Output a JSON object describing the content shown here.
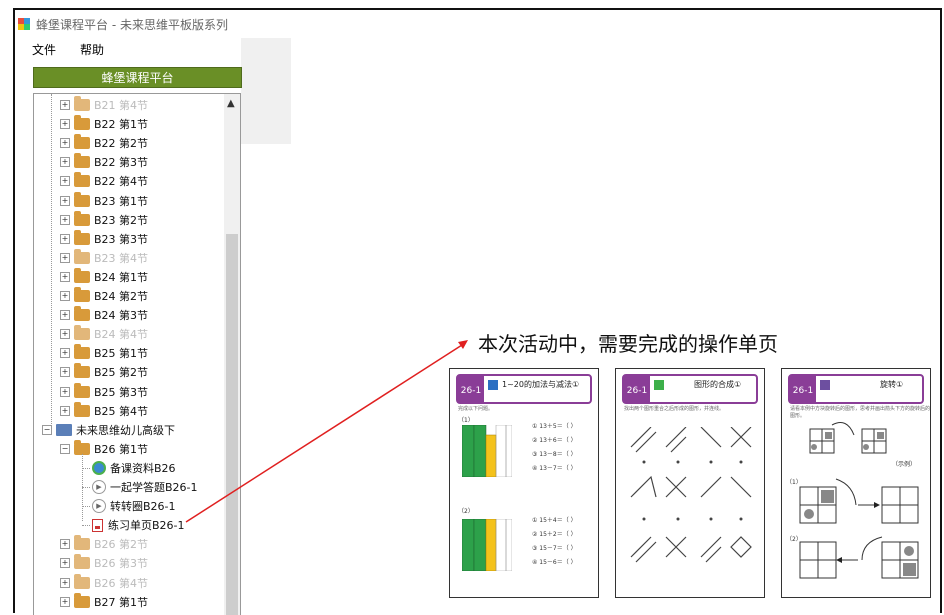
{
  "window": {
    "title": "蜂堡课程平台 - 未来思维平板版系列"
  },
  "menu": {
    "file": "文件",
    "help": "帮助"
  },
  "platform_button": "蜂堡课程平台",
  "tree": {
    "items": [
      {
        "label": "B21 第4节",
        "dim": true
      },
      {
        "label": "B22 第1节",
        "dim": false
      },
      {
        "label": "B22 第2节",
        "dim": false
      },
      {
        "label": "B22 第3节",
        "dim": false
      },
      {
        "label": "B22 第4节",
        "dim": false
      },
      {
        "label": "B23 第1节",
        "dim": false
      },
      {
        "label": "B23 第2节",
        "dim": false
      },
      {
        "label": "B23 第3节",
        "dim": false
      },
      {
        "label": "B23 第4节",
        "dim": true
      },
      {
        "label": "B24 第1节",
        "dim": false
      },
      {
        "label": "B24 第2节",
        "dim": false
      },
      {
        "label": "B24 第3节",
        "dim": false
      },
      {
        "label": "B24 第4节",
        "dim": true
      },
      {
        "label": "B25 第1节",
        "dim": false
      },
      {
        "label": "B25 第2节",
        "dim": false
      },
      {
        "label": "B25 第3节",
        "dim": false
      },
      {
        "label": "B25 第4节",
        "dim": false
      }
    ],
    "group": "未来思维幼儿高级下",
    "section": "B26 第1节",
    "children": [
      "备课资料B26",
      "一起学答题B26-1",
      "转转圈B26-1",
      "练习单页B26-1"
    ],
    "after": [
      {
        "label": "B26 第2节",
        "dim": true
      },
      {
        "label": "B26 第3节",
        "dim": true
      },
      {
        "label": "B26 第4节",
        "dim": true
      },
      {
        "label": "B27 第1节",
        "dim": false
      }
    ]
  },
  "annotation": "本次活动中，需要完成的操作单页",
  "cards": [
    {
      "badge": "26-1",
      "title": "1~20的加法与减法①",
      "instruction": "完成以下问题。",
      "items": [
        "① 13＋5＝（  ）",
        "② 13＋6＝（  ）",
        "③ 13－8＝（  ）",
        "④ 13－7＝（  ）",
        "① 15＋4＝（  ）",
        "② 15＋2＝（  ）",
        "③ 15－7＝（  ）",
        "④ 15－6＝（  ）"
      ],
      "parts": [
        "（1）",
        "（2）"
      ]
    },
    {
      "badge": "26-1",
      "title": "图形的合成①",
      "instruction": "找出两个图形重合之后形成的图形，并连线。"
    },
    {
      "badge": "26-1",
      "title": "旋转①",
      "instruction": "请看本例中方块旋转后的图形，思考并画出箭头下方的旋转后的图形。",
      "example": "（示例）",
      "parts": [
        "（1）",
        "（2）"
      ]
    }
  ],
  "colors": {
    "accent": "#6a8f26",
    "card_purple": "#8a3d97",
    "arrow": "#e02020",
    "folder": "#d89a3a"
  }
}
